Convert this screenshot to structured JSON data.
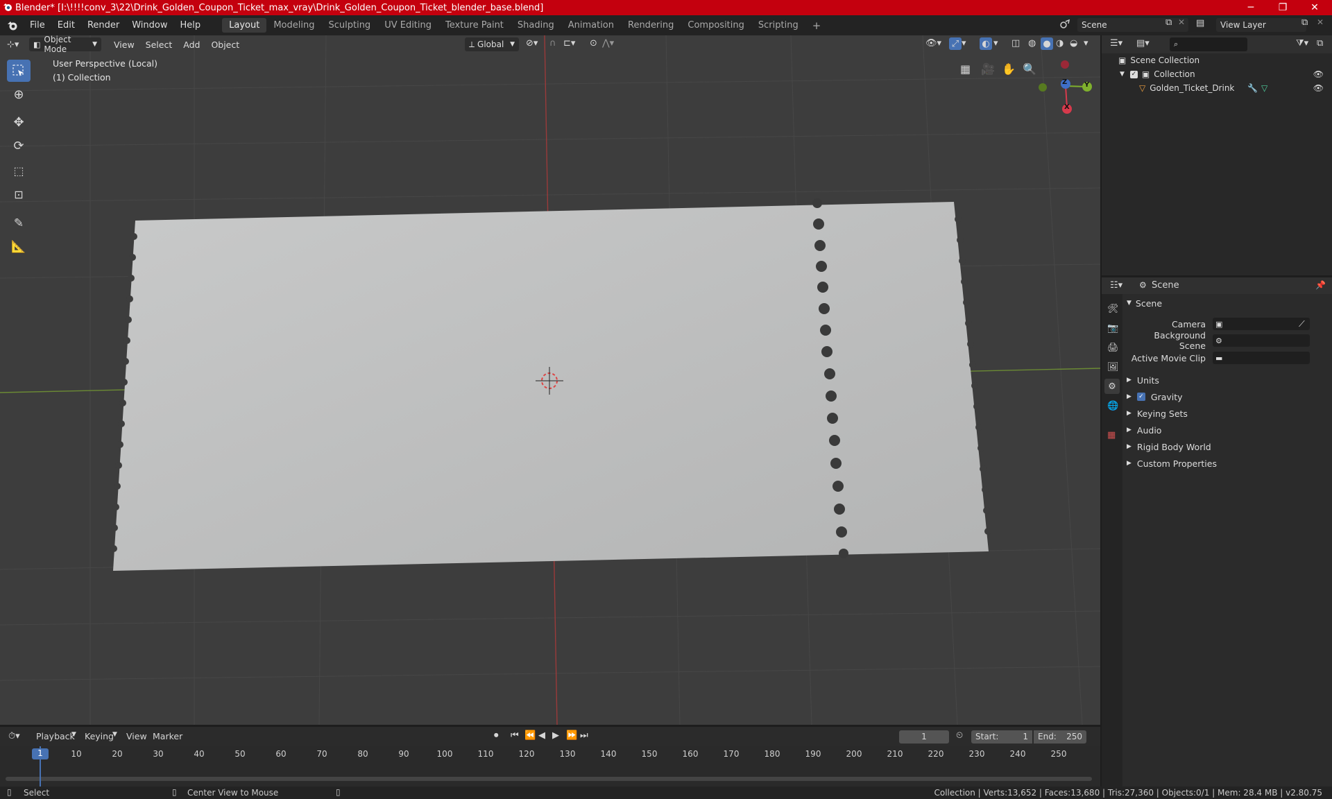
{
  "window": {
    "title": "Blender* [I:\\!!!!conv_3\\22\\Drink_Golden_Coupon_Ticket_max_vray\\Drink_Golden_Coupon_Ticket_blender_base.blend]",
    "minimize": "─",
    "maximize": "❐",
    "close": "✕"
  },
  "menus": [
    "File",
    "Edit",
    "Render",
    "Window",
    "Help"
  ],
  "workspaces": [
    "Layout",
    "Modeling",
    "Sculpting",
    "UV Editing",
    "Texture Paint",
    "Shading",
    "Animation",
    "Rendering",
    "Compositing",
    "Scripting"
  ],
  "scene": {
    "label": "Scene",
    "view_layer": "View Layer"
  },
  "viewport": {
    "mode": "Object Mode",
    "menus": [
      "View",
      "Select",
      "Add",
      "Object"
    ],
    "orientation": "Global",
    "perspective": "User Perspective (Local)",
    "collection": "(1) Collection"
  },
  "gizmo": {
    "z": "Z",
    "y": "Y",
    "x": "X"
  },
  "outliner": {
    "root": "Scene Collection",
    "collection": "Collection",
    "object": "Golden_Ticket_Drink"
  },
  "properties": {
    "context": "Scene",
    "panel": "Scene",
    "camera_label": "Camera",
    "bg_scene_label": "Background Scene",
    "movie_clip_label": "Active Movie Clip",
    "sections": [
      "Units",
      "Gravity",
      "Keying Sets",
      "Audio",
      "Rigid Body World",
      "Custom Properties"
    ]
  },
  "timeline": {
    "menus": [
      "Playback",
      "Keying",
      "View",
      "Marker"
    ],
    "current_frame": "1",
    "start_label": "Start:",
    "start": "1",
    "end_label": "End:",
    "end": "250",
    "ticks": [
      "1",
      "10",
      "20",
      "30",
      "40",
      "50",
      "60",
      "70",
      "80",
      "90",
      "100",
      "110",
      "120",
      "130",
      "140",
      "150",
      "160",
      "170",
      "180",
      "190",
      "200",
      "210",
      "220",
      "230",
      "240",
      "250"
    ]
  },
  "status": {
    "select": "Select",
    "center": "Center View to Mouse",
    "stats": "Collection | Verts:13,652 | Faces:13,680 | Tris:27,360 | Objects:0/1 | Mem: 28.4 MB | v2.80.75"
  }
}
